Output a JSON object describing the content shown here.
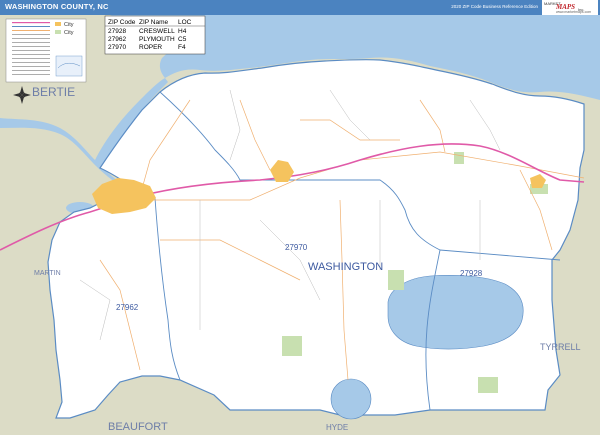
{
  "header": {
    "title": "WASHINGTON COUNTY, NC",
    "edition": "2020 ZIP Code Business Reference Edition",
    "logo_line1": "MARKET",
    "logo_line2": "MAPS",
    "logo_line3": "Inc.",
    "logo_line4": "www.marketmaps.com"
  },
  "legend_labels": {
    "city": "City",
    "city2": "City"
  },
  "zip_table": {
    "headers": [
      "ZIP Code",
      "ZIP Name",
      "LOC"
    ],
    "rows": [
      [
        "27928",
        "CRESWELL",
        "H4"
      ],
      [
        "27962",
        "PLYMOUTH",
        "C5"
      ],
      [
        "27970",
        "ROPER",
        "F4"
      ]
    ]
  },
  "map_labels": {
    "county": "WASHINGTON",
    "bertie": "BERTIE",
    "martin": "MARTIN",
    "tyrrell": "TYRRELL",
    "beaufort": "BEAUFORT",
    "hyde": "HYDE",
    "zip_27970": "27970",
    "zip_27962": "27962",
    "zip_27928": "27928"
  },
  "colors": {
    "water": "#a6c9e8",
    "land_outside": "#dcdcc6",
    "county": "#ffffff",
    "boundary": "#5b8cc4",
    "highway": "#e05aa8",
    "road": "#f0b070",
    "city": "#f5c35e",
    "park": "#c8e0b0",
    "header": "#4b83c0"
  }
}
